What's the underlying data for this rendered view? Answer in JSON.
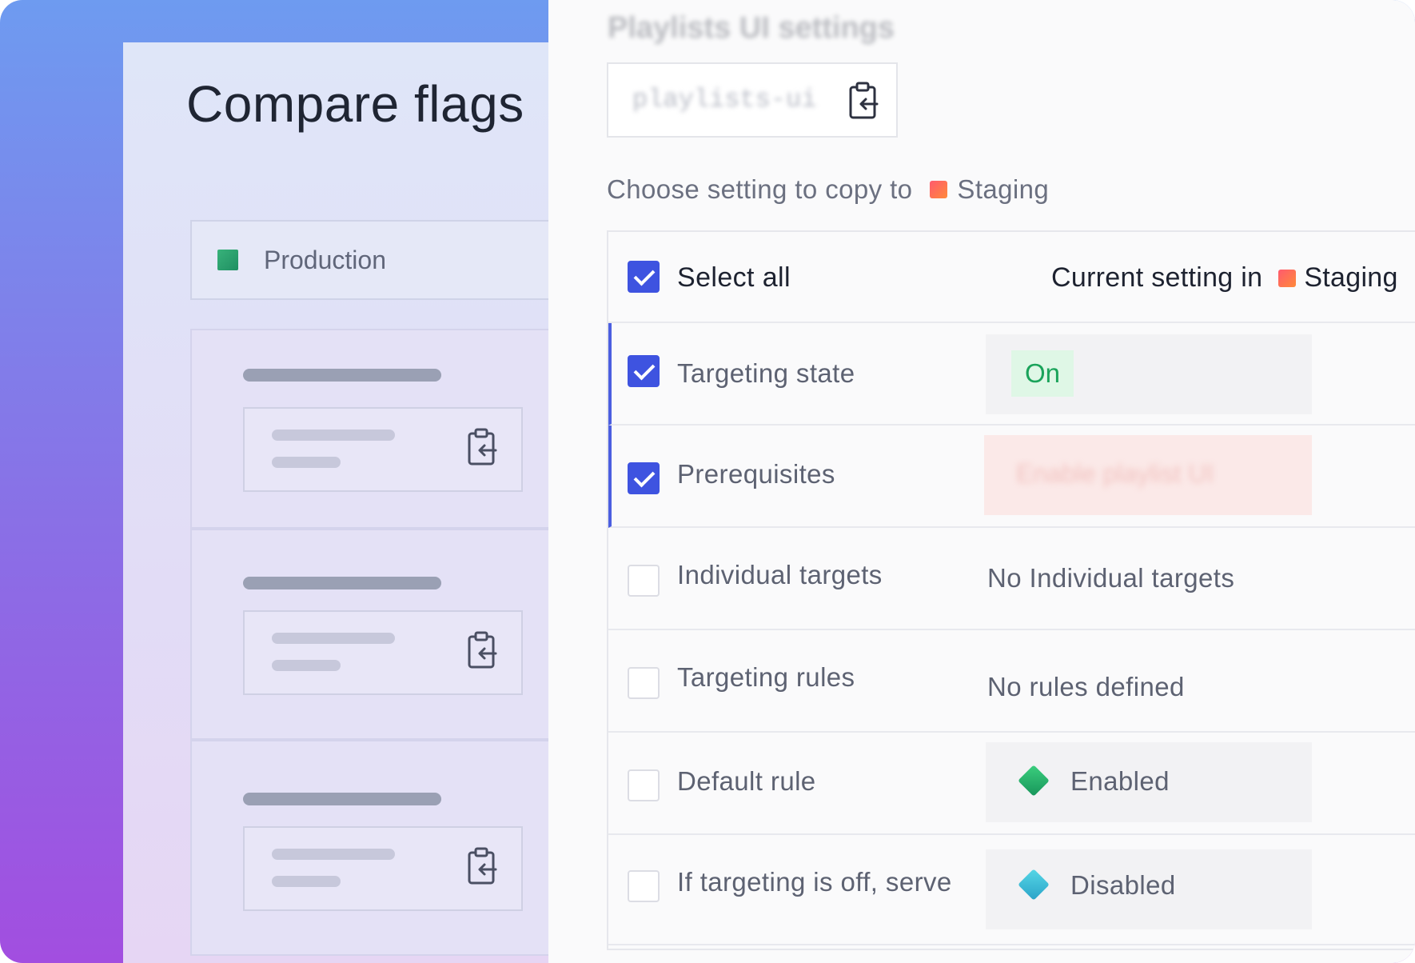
{
  "left": {
    "title": "Compare flags",
    "environment": "Production"
  },
  "right": {
    "blurred_title": "Playlists UI settings",
    "flag_key": "playlists-ui",
    "choose_prefix": "Choose setting to copy to",
    "target_env": "Staging",
    "header": {
      "select_all": "Select all",
      "current_setting": "Current setting in",
      "env": "Staging"
    },
    "rows": [
      {
        "label": "Targeting state",
        "checked": true,
        "value": "On"
      },
      {
        "label": "Prerequisites",
        "checked": true,
        "value": "Enable playlist UI"
      },
      {
        "label": "Individual targets",
        "checked": false,
        "value": "No Individual targets"
      },
      {
        "label": "Targeting rules",
        "checked": false,
        "value": "No rules defined"
      },
      {
        "label": "Default rule",
        "checked": false,
        "value": "Enabled",
        "value_color": "#1f9d63"
      },
      {
        "label": "If targeting is off, serve",
        "checked": false,
        "value": "Disabled",
        "value_color": "#3bb7d4"
      }
    ]
  },
  "colors": {
    "accent": "#3e53e0",
    "on_bg": "#dff7e6",
    "on_text": "#1aa35a"
  }
}
